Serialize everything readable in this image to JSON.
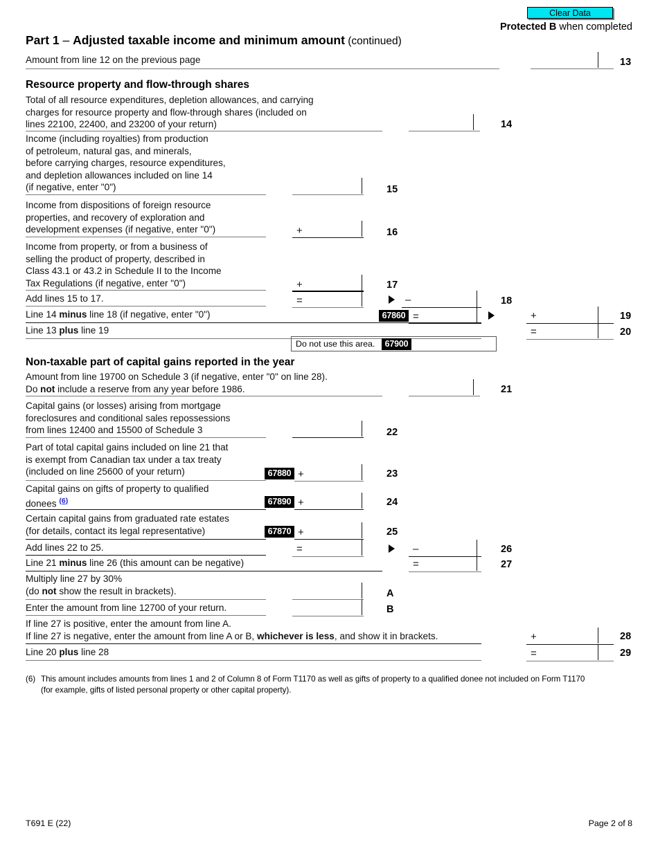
{
  "header": {
    "clear_data_label": "Clear Data",
    "protected_bold": "Protected B",
    "protected_rest": " when completed",
    "part_label": "Part 1",
    "part_dash": " – ",
    "part_title": "Adjusted taxable income and minimum amount",
    "part_continued": " (continued)"
  },
  "line13": {
    "text": "Amount from line 12 on the previous page",
    "number": "13"
  },
  "section_resource": {
    "heading": "Resource property and flow-through shares"
  },
  "line14": {
    "text": "Total of all resource expenditures, depletion allowances, and carrying\ncharges for resource property and flow-through shares (included on\nlines 22100, 22400, and 23200 of your return)",
    "number": "14"
  },
  "line15": {
    "text": "Income (including royalties) from production\nof petroleum, natural gas, and minerals,\nbefore carrying charges, resource expenditures,\nand depletion allowances included on line 14\n(if negative, enter \"0\")",
    "number": "15",
    "operator": ""
  },
  "line16": {
    "text": "Income from dispositions of foreign resource\nproperties, and recovery of exploration and\ndevelopment expenses (if negative, enter \"0\")",
    "number": "16",
    "operator": "+"
  },
  "line17": {
    "text": "Income from property, or from a business of\nselling the product of property, described in\nClass 43.1 or 43.2 in Schedule II to the Income\nTax Regulations (if negative, enter \"0\")",
    "number": "17",
    "operator": "+"
  },
  "line18": {
    "text": "Add lines 15 to 17.",
    "number": "18",
    "operator_left": "=",
    "operator_right": "–"
  },
  "line19": {
    "text_a": "Line 14 ",
    "text_b": "minus",
    "text_c": " line 18 (if negative, enter \"0\")",
    "number": "19",
    "code": "67860",
    "operator_left": "=",
    "operator_right": "+"
  },
  "line20": {
    "text_a": "Line 13 ",
    "text_b": "plus",
    "text_c": " line 19",
    "number": "20",
    "operator": "="
  },
  "do_not_use": {
    "label": "Do not use this area.",
    "code": "67900"
  },
  "section_nontaxable": {
    "heading": "Non-taxable part of capital gains reported in the year"
  },
  "line21": {
    "text_l1": "Amount from line 19700 on Schedule 3 (if negative, enter \"0\" on line 28).",
    "text_l2_a": "Do ",
    "text_l2_b": "not",
    "text_l2_c": " include a reserve from any year before 1986.",
    "number": "21"
  },
  "line22": {
    "text": "Capital gains (or losses) arising from mortgage\nforeclosures and conditional sales repossessions\nfrom lines 12400 and 15500 of Schedule 3",
    "number": "22"
  },
  "line23": {
    "text": "Part of total capital gains included on line 21 that\nis exempt from Canadian tax under a tax treaty\n(included on line 25600 of your return)",
    "number": "23",
    "code": "67880",
    "operator": "+"
  },
  "line24": {
    "text_l1": "Capital gains on gifts of property to qualified",
    "text_l2": "donees ",
    "footnote_ref": "(6)",
    "number": "24",
    "code": "67890",
    "operator": "+"
  },
  "line25": {
    "text": "Certain capital gains from graduated rate estates\n(for details, contact its legal representative)",
    "number": "25",
    "code": "67870",
    "operator": "+"
  },
  "line26": {
    "text": "Add lines 22 to 25.",
    "number": "26",
    "operator_left": "=",
    "operator_right": "–"
  },
  "line27": {
    "text_a": "Line 21 ",
    "text_b": "minus",
    "text_c": " line 26 (this amount can be negative)",
    "number": "27",
    "operator": "="
  },
  "lineA": {
    "text_l1": "Multiply line 27 by 30%",
    "text_l2_a": "(do ",
    "text_l2_b": "not",
    "text_l2_c": " show the result in brackets).",
    "number": "A"
  },
  "lineB": {
    "text": "Enter the amount from line 12700 of your return.",
    "number": "B"
  },
  "line28": {
    "text_l1": "If line 27 is positive, enter the amount from line A.",
    "text_l2_a": "If line 27 is negative, enter the amount from line A or B, ",
    "text_l2_b": "whichever is less",
    "text_l2_c": ", and show it in brackets.",
    "number": "28",
    "operator": "+"
  },
  "line29": {
    "text_a": "Line 20 ",
    "text_b": "plus",
    "text_c": " line 28",
    "number": "29",
    "operator": "="
  },
  "footnote": {
    "marker": "(6)",
    "line1": "This amount includes amounts from lines 1 and 2 of Column 8 of Form T1170 as well as gifts of property to a qualified donee not included on Form T1170",
    "line2": "(for example, gifts of listed personal property or other capital property)."
  },
  "footer": {
    "form_id": "T691 E (22)",
    "page": "Page 2 of 8"
  },
  "colors": {
    "clear_data_bg": "#00e5f0",
    "code_box_bg": "#000000",
    "code_box_fg": "#ffffff",
    "footnote_link": "#2222cc",
    "rule": "#7a7a7a"
  }
}
